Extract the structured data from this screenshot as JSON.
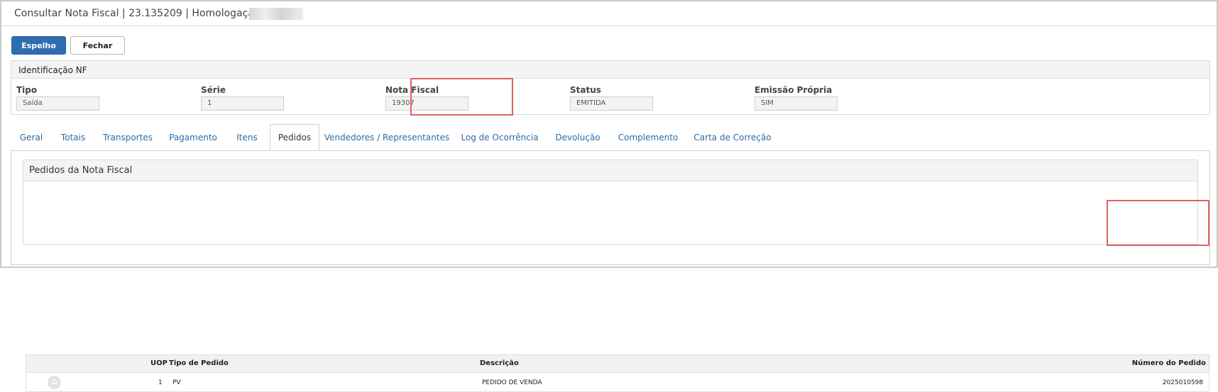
{
  "window": {
    "title": "Consultar Nota Fiscal | 23.135209 | Homologação |"
  },
  "toolbar": {
    "espelho_label": "Espelho",
    "fechar_label": "Fechar"
  },
  "identificacao": {
    "title": "Identificação NF",
    "fields": [
      {
        "label": "Tipo",
        "value": "Saída"
      },
      {
        "label": "Série",
        "value": "1"
      },
      {
        "label": "Nota Fiscal",
        "value": "19307"
      },
      {
        "label": "Status",
        "value": "EMITIDA"
      },
      {
        "label": "Emissão Própria",
        "value": "SIM"
      }
    ]
  },
  "tabs": [
    {
      "label": "Geral"
    },
    {
      "label": "Totais"
    },
    {
      "label": "Transportes"
    },
    {
      "label": "Pagamento"
    },
    {
      "label": "Itens"
    },
    {
      "label": "Pedidos"
    },
    {
      "label": "Vendedores / Representantes"
    },
    {
      "label": "Log de Ocorrência"
    },
    {
      "label": "Devolução"
    },
    {
      "label": "Complemento"
    },
    {
      "label": "Carta de Correção"
    }
  ],
  "active_tab": "Pedidos",
  "pedidos": {
    "title": "Pedidos da Nota Fiscal",
    "columns": {
      "uop": "UOP",
      "tipo": "Tipo de Pedido",
      "descricao": "Descrição",
      "numero": "Número do Pedido"
    },
    "rows": [
      {
        "uop": "1",
        "tipo": "PV",
        "descricao": "PEDIDO DE VENDA",
        "numero": "2025010598"
      }
    ]
  },
  "colors": {
    "primary": "#2f6db0",
    "link": "#2f6aa3",
    "highlight": "#e06066"
  },
  "icons": {
    "row_action": "search-icon"
  }
}
